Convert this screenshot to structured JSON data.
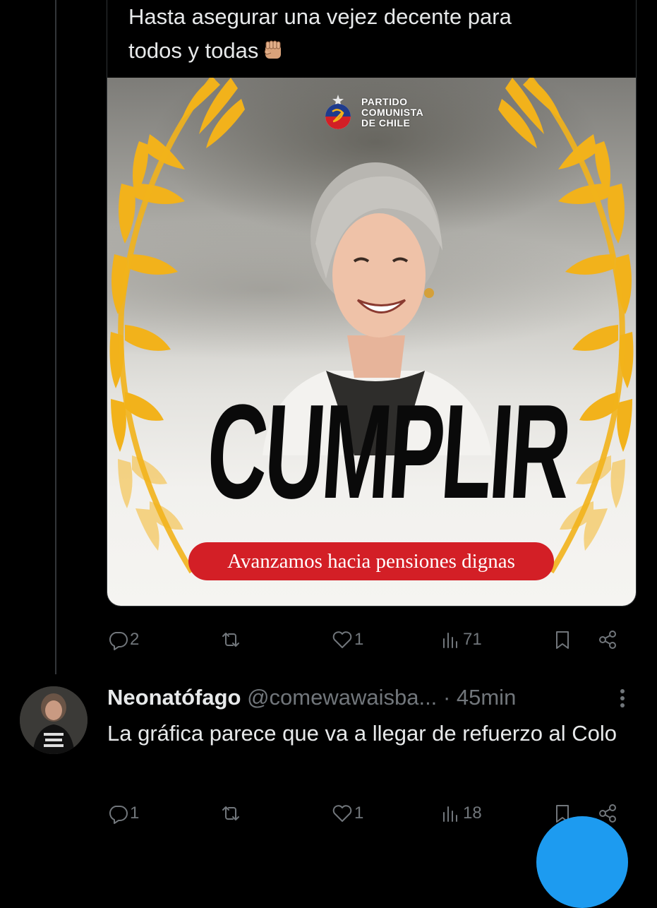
{
  "quoted_tweet": {
    "text": "Hasta asegurar una vejez decente para\ntodos y todas",
    "emoji": "raised-fist",
    "poster": {
      "party_name": "PARTIDO\nCOMUNISTA\nDE CHILE",
      "headline": "CUMPLIR",
      "slogan": "Avanzamos hacia pensiones dignas",
      "colors": {
        "slogan_bg": "#d31f26",
        "wheat": "#f2b21b",
        "headline": "#0a0a0a"
      }
    }
  },
  "quoted_actions": {
    "replies": "2",
    "retweets": "",
    "likes": "1",
    "views": "71"
  },
  "reply": {
    "author_name": "Neonatófago",
    "handle": "@comewawaisba...",
    "time": "· 45min",
    "text": "La gráfica parece que va a llegar de refuerzo al Colo"
  },
  "reply_actions": {
    "replies": "1",
    "retweets": "",
    "likes": "1",
    "views": "18"
  },
  "icons": [
    "reply-icon",
    "retweet-icon",
    "like-icon",
    "views-icon",
    "bookmark-icon",
    "share-icon",
    "more-icon"
  ],
  "accent": "#1d9bf0"
}
